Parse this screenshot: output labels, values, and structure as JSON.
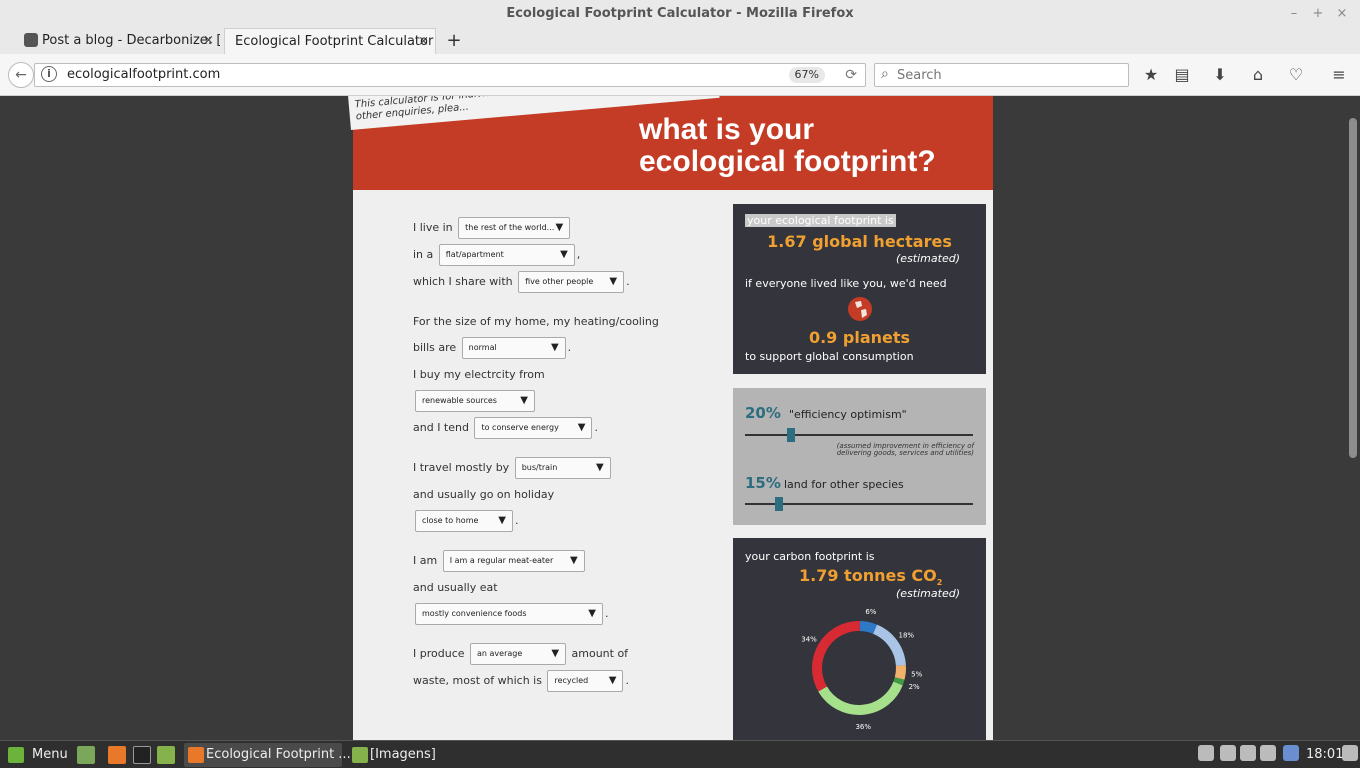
{
  "window": {
    "title": "Ecological Footprint Calculator - Mozilla Firefox",
    "controls": [
      "–",
      "+",
      "×"
    ]
  },
  "tabs": [
    {
      "label": "Post a blog - Decarbonize: [",
      "close": "×"
    },
    {
      "label": "Ecological Footprint Calculator",
      "close": "×"
    }
  ],
  "newtab": "+",
  "nav": {
    "back": "←",
    "info": "i",
    "url": "ecologicalfootprint.com",
    "zoom": "67%",
    "reload": "⟳",
    "search_placeholder": "Search",
    "search_icon": "⌕",
    "toolbar_icons": [
      "★",
      "▤",
      "⬇",
      "⌂",
      "♡",
      "≡"
    ]
  },
  "hero": {
    "note": "This calculator is for individuals and ... For more precise answers and other enquiries, plea...",
    "title_line1": "what is your",
    "title_line2": "ecological footprint?"
  },
  "form": {
    "live_in_label": "I live in",
    "live_in_value": "the rest of the world...",
    "in_a_label": "in a",
    "in_a_value": "flat/apartment",
    "share_label": "which I share with",
    "share_value": "five other people",
    "size_label": "For the size of my home, my heating/cooling",
    "bills_label": "bills are",
    "bills_value": "normal",
    "electricity_label": "I buy my electrcity from",
    "electricity_value": "renewable sources",
    "tend_label": "and I tend",
    "tend_value": "to conserve energy",
    "travel_label": "I travel mostly by",
    "travel_value": "bus/train",
    "holiday_label": "and usually go on holiday",
    "holiday_value": "close to home",
    "iam_label": "I am",
    "iam_value": "I am a regular meat-eater",
    "eat_label": "and usually eat",
    "eat_value": "mostly convenience foods",
    "produce_label": "I produce",
    "produce_value": "an average",
    "amount_label": "amount of",
    "waste_label": "waste, most of which is",
    "waste_value": "recycled",
    "comma": ",",
    "period": "."
  },
  "footprint": {
    "intro": "your ecological footprint is",
    "value": "1.67 global hectares",
    "estimated": "(estimated)",
    "need_label": "if everyone lived like you, we'd need",
    "planets": "0.9 planets",
    "support": "to support global consumption"
  },
  "sliders": {
    "efficiency_pct": "20%",
    "efficiency_label": "\"efficiency optimism\"",
    "efficiency_value": 0.2,
    "efficiency_note": "(assumed improvement in efficiency of delivering goods, services and utilities)",
    "land_pct": "15%",
    "land_label": "land for other species",
    "land_value": 0.15
  },
  "carbon": {
    "intro": "your carbon footprint is",
    "value": "1.79 tonnes CO",
    "sub": "2",
    "estimated": "(estimated)",
    "segments": [
      {
        "label": "6%",
        "value": 6,
        "color": "#2e78c8"
      },
      {
        "label": "18%",
        "value": 18,
        "color": "#a9c4e6"
      },
      {
        "label": "5%",
        "value": 5,
        "color": "#f2b26b"
      },
      {
        "label": "2%",
        "value": 2,
        "color": "#3f9a45"
      },
      {
        "label": "36%",
        "value": 36,
        "color": "#a6e08b"
      },
      {
        "label": "34%",
        "value": 34,
        "color": "#d82a33"
      }
    ]
  },
  "taskbar": {
    "menu": "Menu",
    "firefox_window": "Ecological Footprint ...",
    "files_window": "[Imagens]",
    "clock": "18:01"
  }
}
